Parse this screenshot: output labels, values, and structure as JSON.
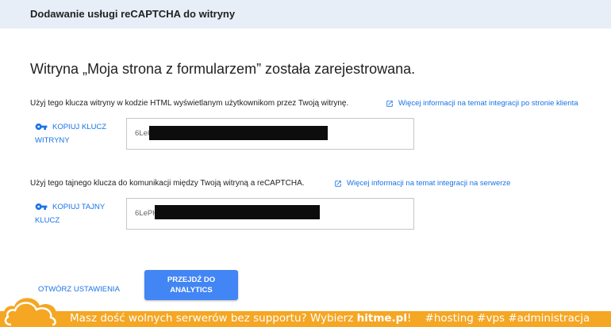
{
  "header": {
    "title": "Dodawanie usługi reCAPTCHA do witryny"
  },
  "main": {
    "heading": "Witryna „Moja strona z formularzem” została zarejestrowana.",
    "site_key": {
      "description": "Użyj tego klucza witryny w kodzie HTML wyświetlanym użytkownikom przez Twoją witrynę.",
      "help_link": "Więcej informacji na temat integracji po stronie klienta",
      "copy_label": "Kopiuj klucz witryny",
      "value_prefix": "6LeH"
    },
    "secret_key": {
      "description": "Użyj tego tajnego klucza do komunikacji między Twoją witryną a reCAPTCHA.",
      "help_link": "Więcej informacji na temat integracji na serwerze",
      "copy_label": "Kopiuj tajny klucz",
      "value_prefix": "6LePH"
    },
    "open_settings_label": "Otwórz ustawienia",
    "analytics_label": "Przejdź do Analytics"
  },
  "banner": {
    "text_before": "Masz dość wolnych serwerów bez supportu? Wybierz",
    "brand": "hitme.pl",
    "text_after": "!    #hosting #vps #administracja"
  },
  "colors": {
    "accent": "#1a73e8",
    "button": "#4285f4",
    "banner": "#f5a623",
    "topbar": "#e8eef8"
  },
  "icons": {
    "key": "key-icon",
    "external_link": "open-in-new-icon",
    "logo": "cloud-logo-icon"
  }
}
